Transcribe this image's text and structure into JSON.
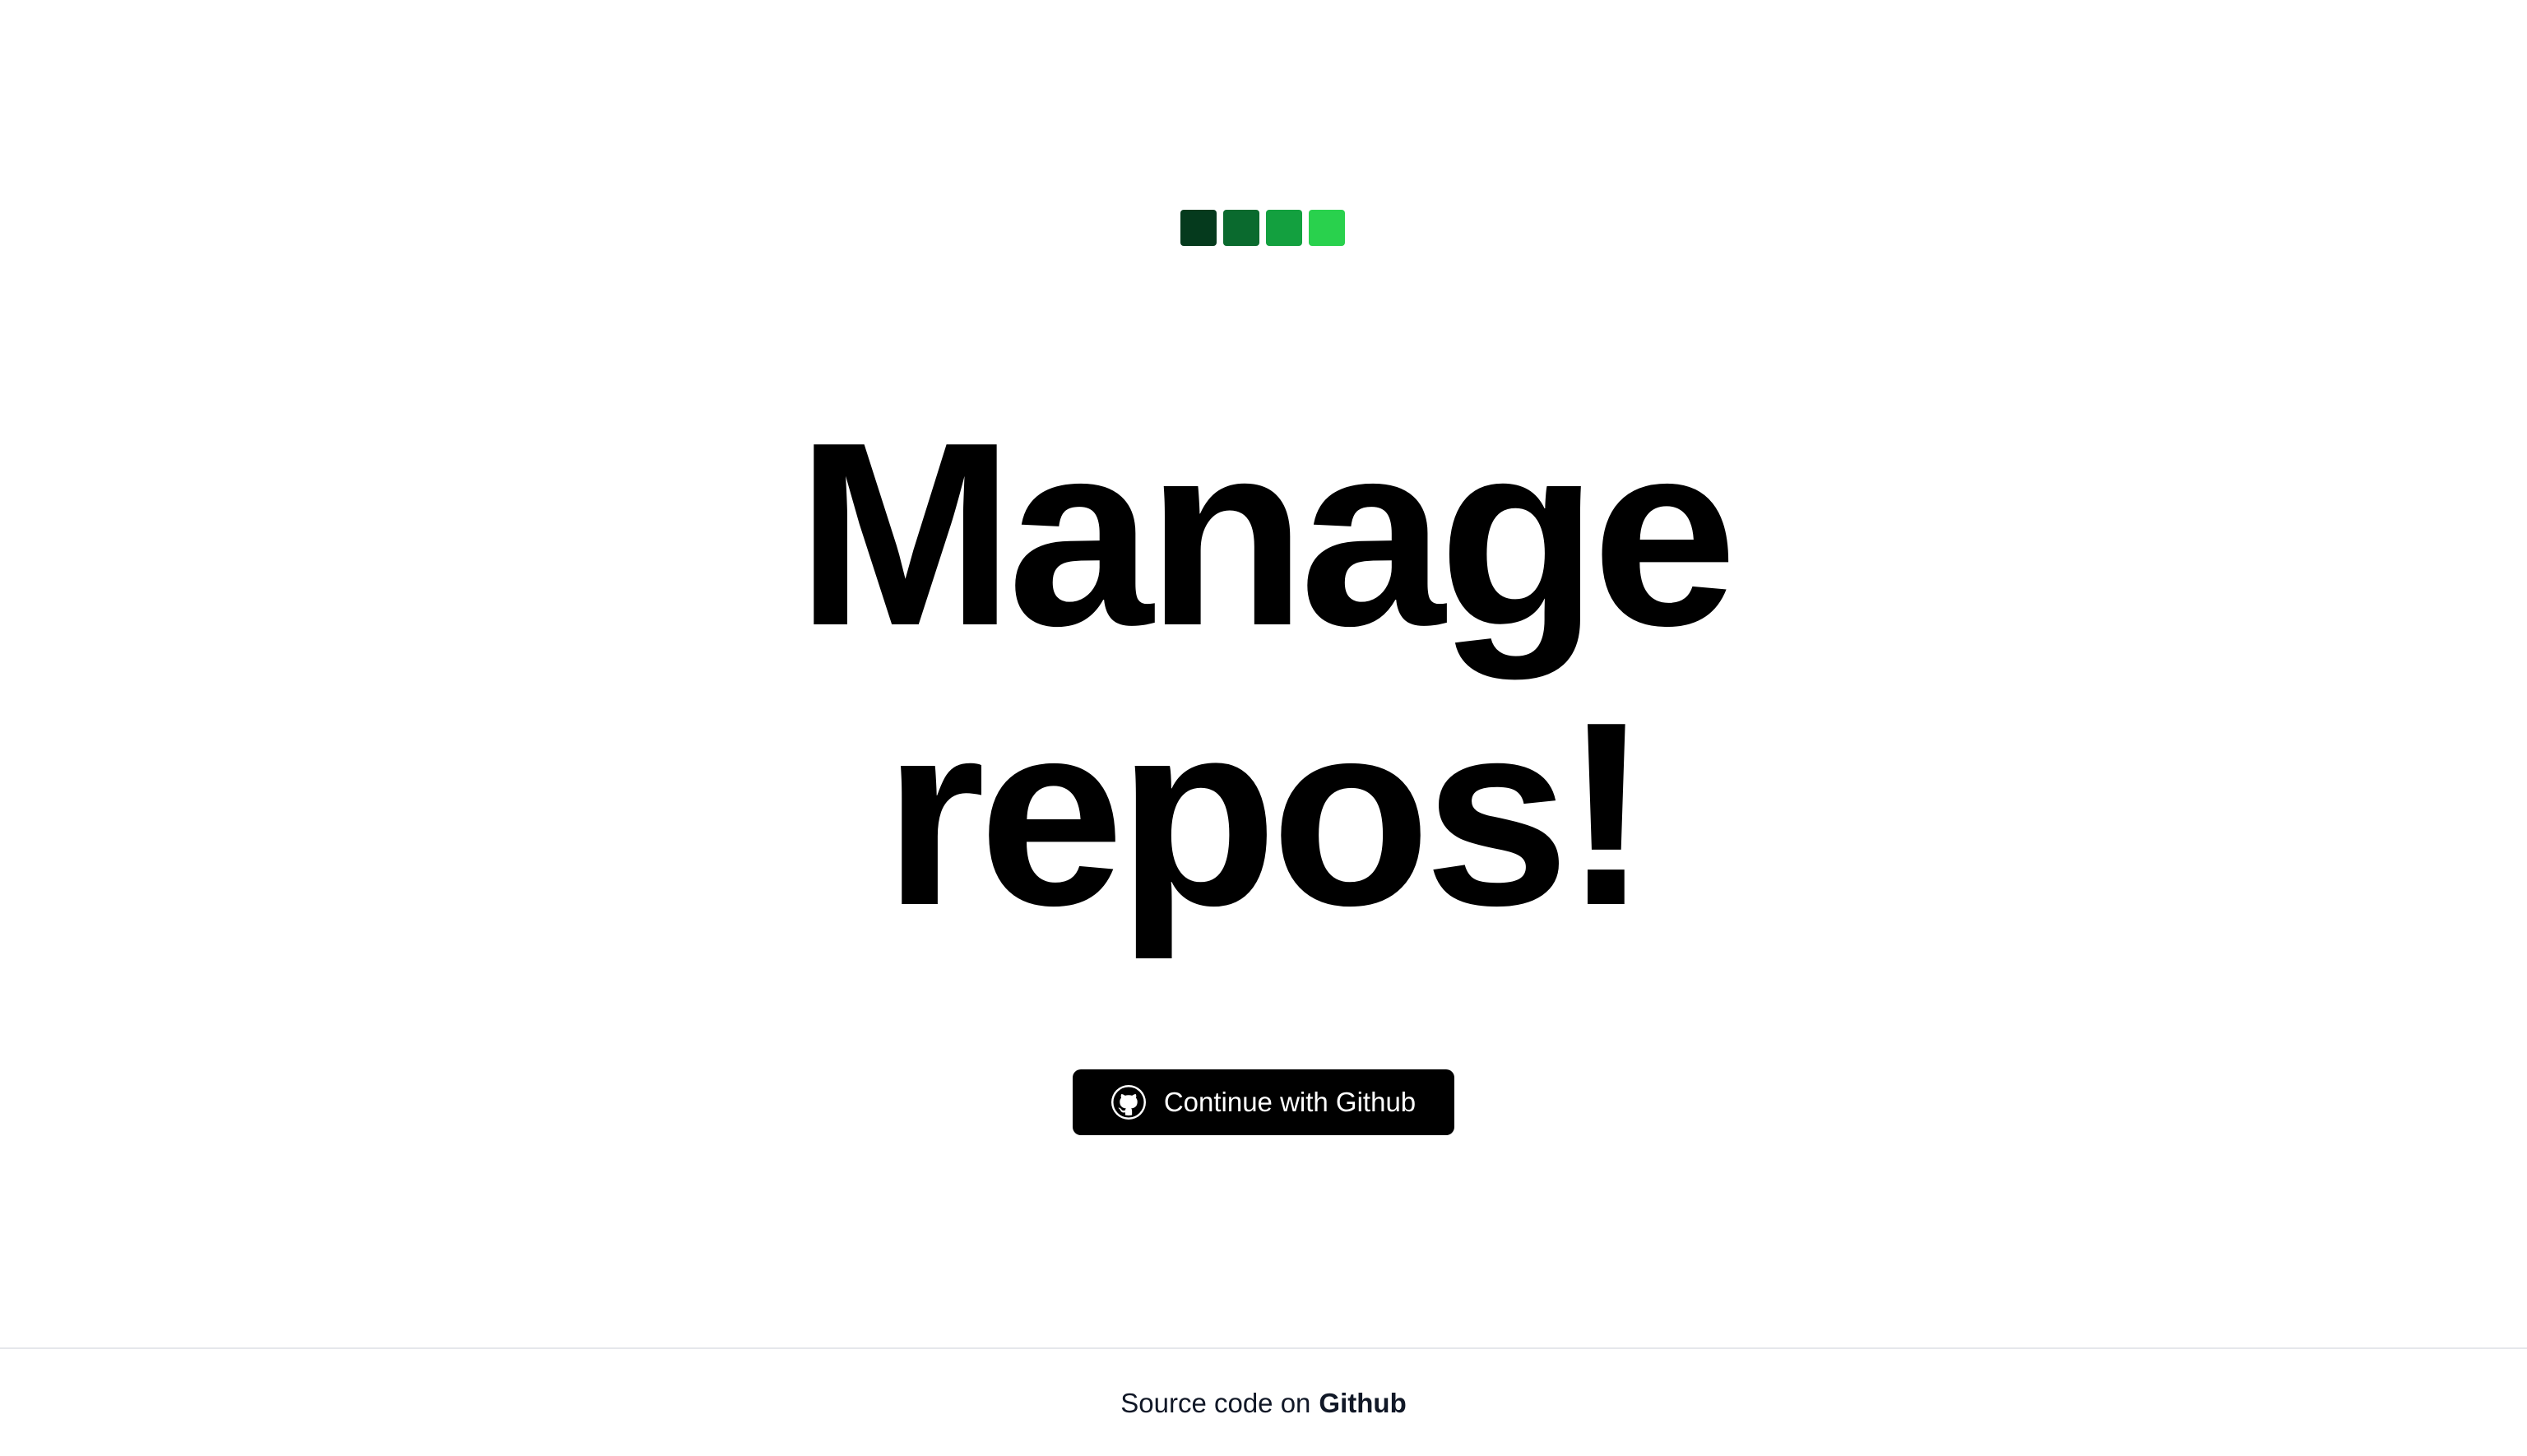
{
  "logo": {
    "colors": [
      "#053a1d",
      "#0a6a2e",
      "#13a03f",
      "#29d14d"
    ]
  },
  "hero": {
    "line1": "Manage",
    "line2": "repos!"
  },
  "cta": {
    "icon": "github-icon",
    "label": "Continue with Github"
  },
  "footer": {
    "prefix": "Source code on",
    "link_label": "Github"
  },
  "colors": {
    "background": "#ffffff",
    "button": "#000000",
    "divider": "#e5e7eb"
  }
}
